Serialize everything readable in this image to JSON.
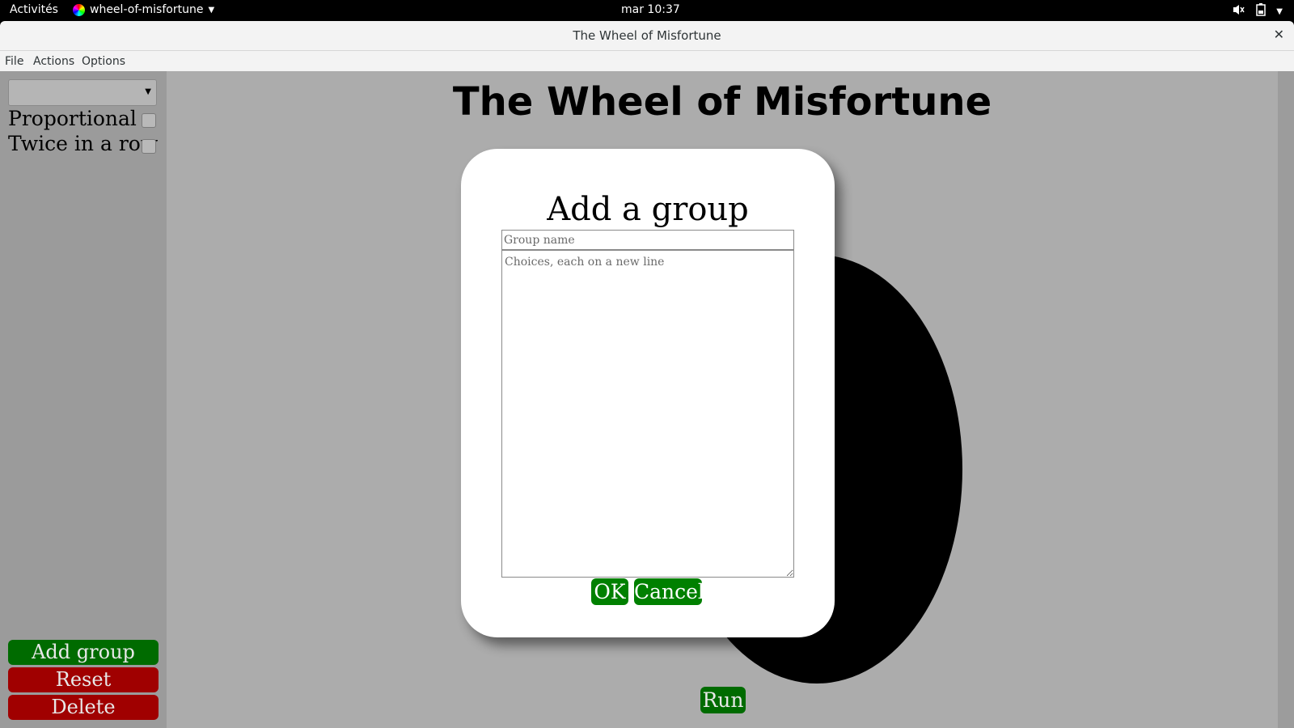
{
  "topbar": {
    "activities": "Activités",
    "app_name": "wheel-of-misfortune",
    "clock": "mar 10:37",
    "icons": [
      "volume-icon",
      "battery-icon",
      "menu-caret-icon"
    ]
  },
  "window": {
    "title": "The Wheel of Misfortune"
  },
  "menubar": {
    "items": [
      "File",
      "Actions",
      "Options"
    ]
  },
  "sidebar": {
    "group_select_value": "",
    "proportional_label": "Proportional",
    "proportional_checked": false,
    "twice_label": "Twice in a row",
    "twice_checked": false,
    "add_group_label": "Add group",
    "reset_label": "Reset",
    "delete_label": "Delete"
  },
  "main": {
    "title": "The Wheel of Misfortune",
    "run_label": "Run"
  },
  "dialog": {
    "title": "Add a group",
    "group_name_placeholder": "Group name",
    "choices_placeholder": "Choices, each on a new line",
    "ok_label": "OK",
    "cancel_label": "Cancel"
  },
  "colors": {
    "button_green": "#008000",
    "button_dark_green": "#006b00",
    "button_red": "#a00000",
    "background_gray": "#acacac",
    "sidebar_gray": "#9b9b9b"
  }
}
